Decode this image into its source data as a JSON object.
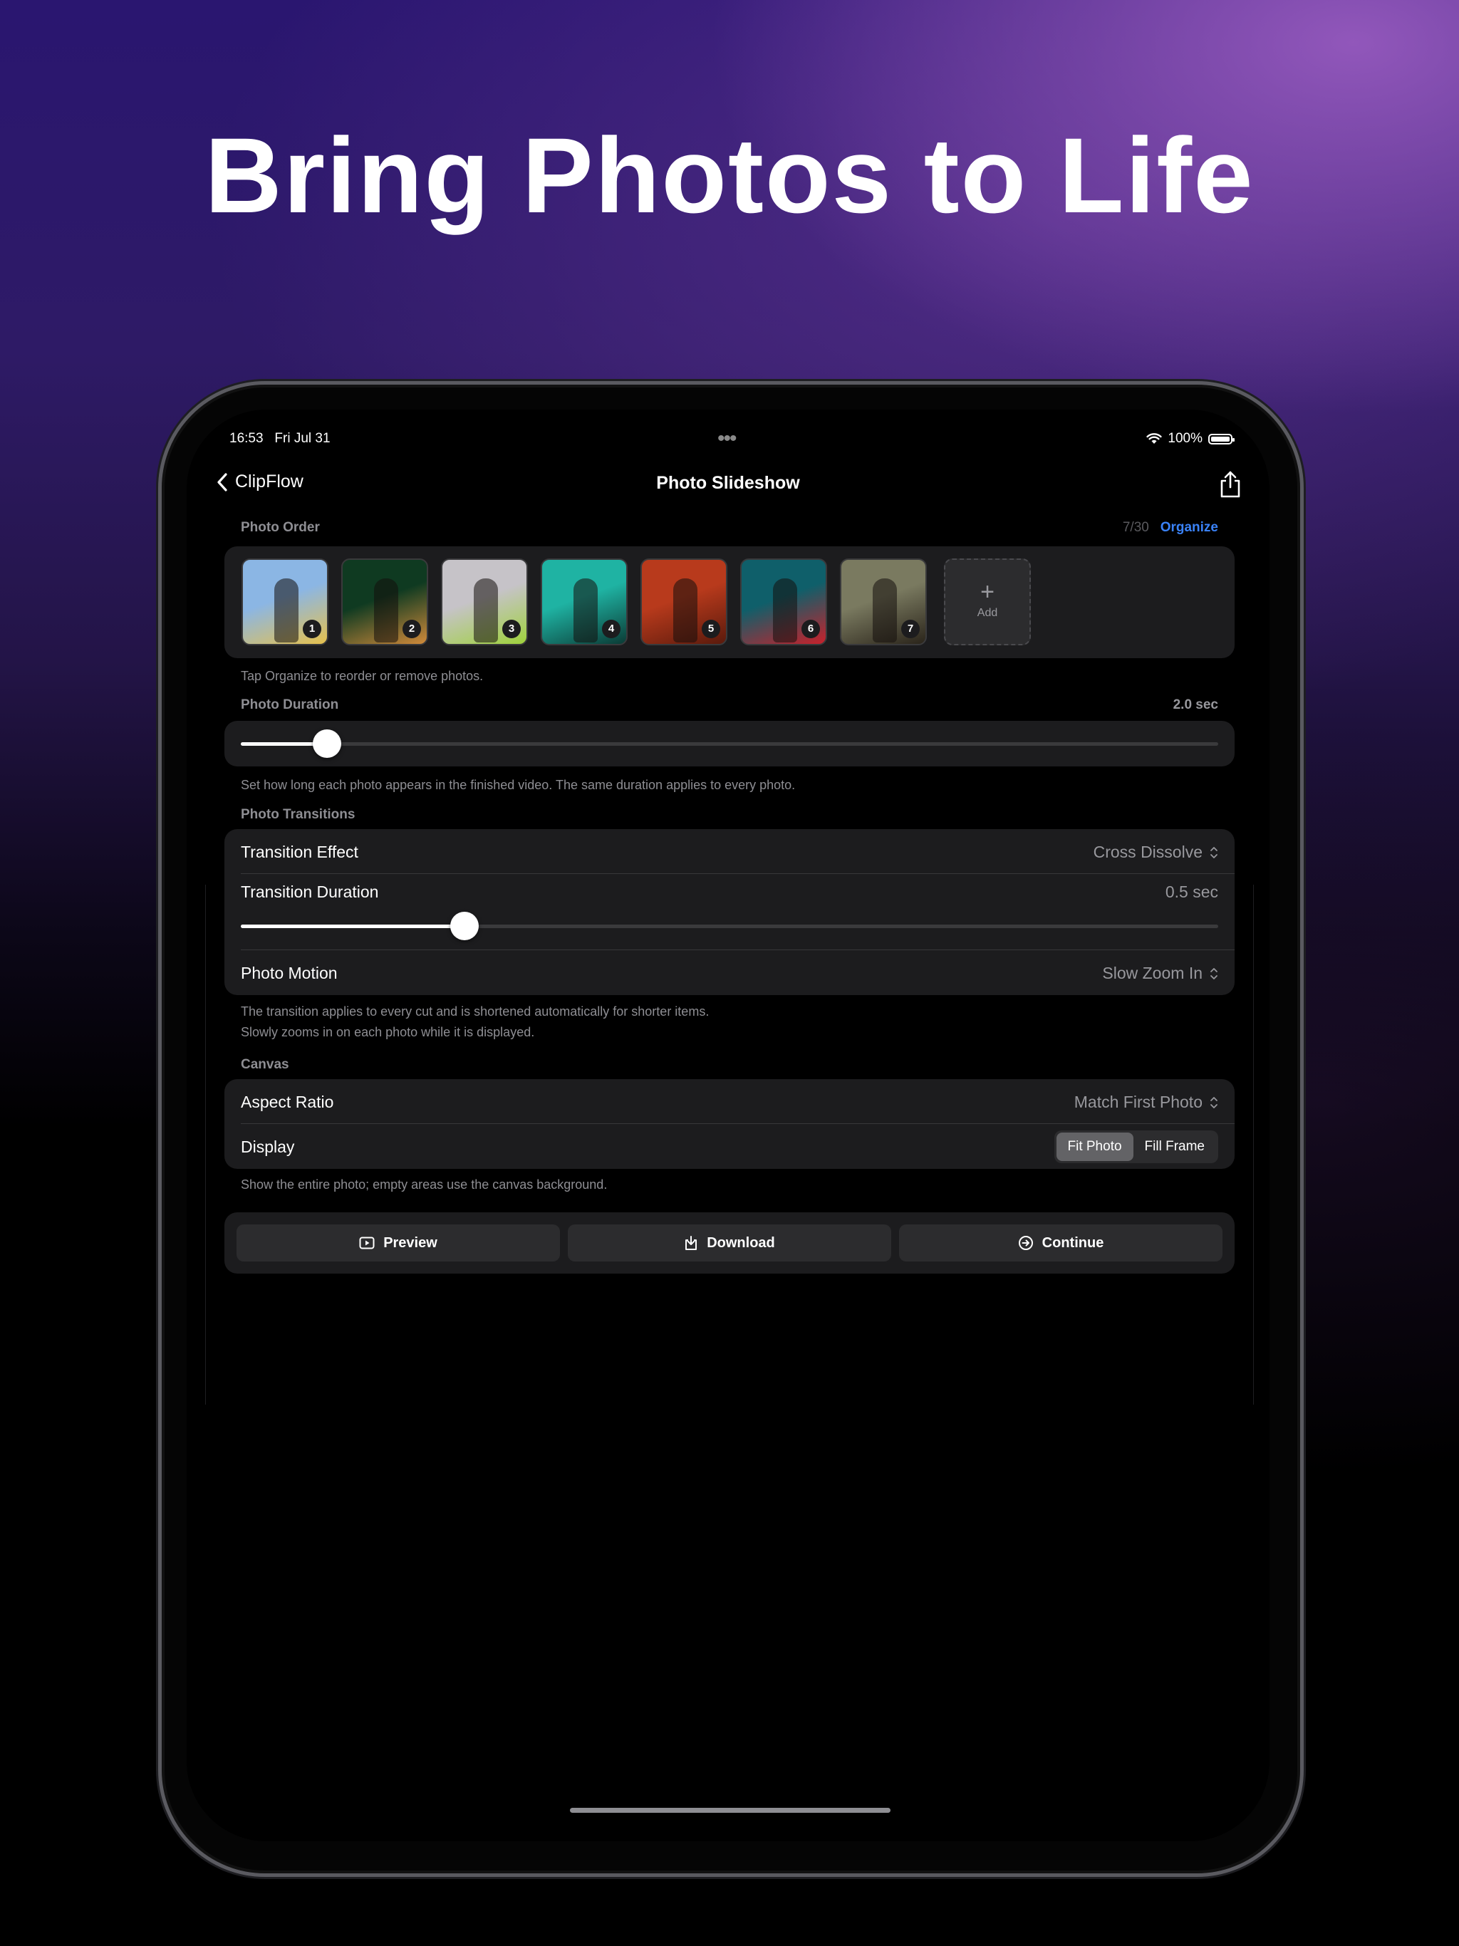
{
  "headline": "Bring Photos to Life",
  "status": {
    "time": "16:53",
    "date": "Fri Jul 31",
    "battery": "100%"
  },
  "nav": {
    "back_label": "ClipFlow",
    "title": "Photo Slideshow"
  },
  "photo_order": {
    "label": "Photo Order",
    "count": "7/30",
    "organize_label": "Organize",
    "photos": [
      {
        "badge": "1",
        "colors": [
          "#8bb6e4",
          "#e6c14d"
        ]
      },
      {
        "badge": "2",
        "colors": [
          "#0f3a21",
          "#d08a3a"
        ]
      },
      {
        "badge": "3",
        "colors": [
          "#c6c3c8",
          "#9fd23b"
        ]
      },
      {
        "badge": "4",
        "colors": [
          "#1fb3a3",
          "#0b3b35"
        ]
      },
      {
        "badge": "5",
        "colors": [
          "#b83a1c",
          "#5a1a0c"
        ]
      },
      {
        "badge": "6",
        "colors": [
          "#0f5f6a",
          "#c8212b"
        ]
      },
      {
        "badge": "7",
        "colors": [
          "#7a7a60",
          "#2a241a"
        ]
      }
    ],
    "add_label": "Add",
    "hint": "Tap Organize to reorder or remove photos."
  },
  "photo_duration": {
    "label": "Photo Duration",
    "value": "2.0 sec",
    "slider_fraction": 0.088,
    "hint": "Set how long each photo appears in the finished video. The same duration applies to every photo."
  },
  "transitions": {
    "label": "Photo Transitions",
    "effect_label": "Transition Effect",
    "effect_value": "Cross Dissolve",
    "duration_label": "Transition Duration",
    "duration_value": "0.5 sec",
    "duration_fraction": 0.229,
    "motion_label": "Photo Motion",
    "motion_value": "Slow Zoom In",
    "hint_1": "The transition applies to every cut and is shortened automatically for shorter items.",
    "hint_2": "Slowly zooms in on each photo while it is displayed."
  },
  "canvas": {
    "label": "Canvas",
    "aspect_label": "Aspect Ratio",
    "aspect_value": "Match First Photo",
    "display_label": "Display",
    "display_options": [
      "Fit Photo",
      "Fill Frame"
    ],
    "display_selected": "Fit Photo",
    "hint": "Show the entire photo; empty areas use the canvas background."
  },
  "actions": {
    "preview": "Preview",
    "download": "Download",
    "continue": "Continue"
  },
  "colors": {
    "accent": "#3a82f7",
    "card": "#1c1c1e",
    "background": "#000000"
  }
}
